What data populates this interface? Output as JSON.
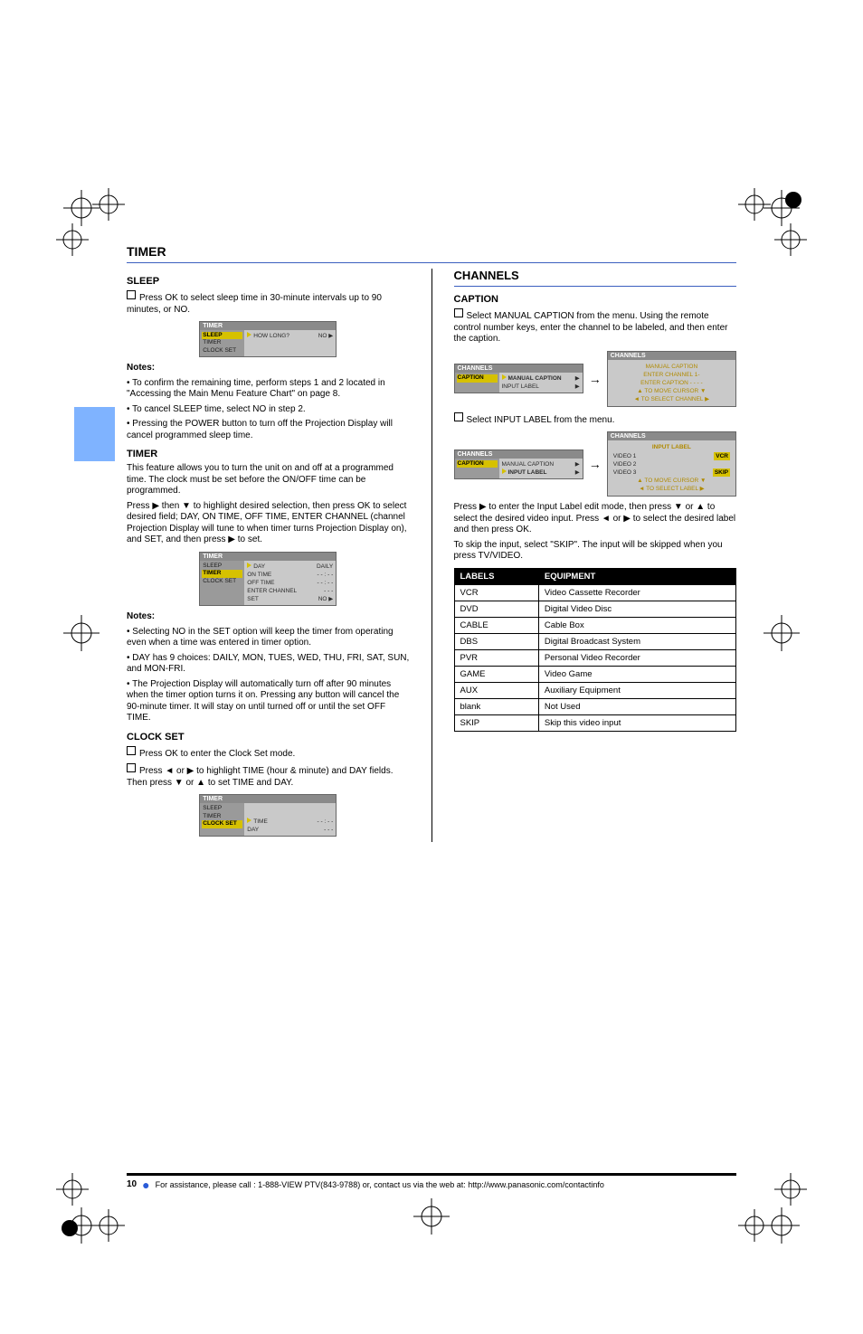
{
  "page": {
    "header_title": "TIMER",
    "footer_page": "10",
    "footer_note": "For assistance, please call : 1-888-VIEW PTV(843-9788) or, contact us via the web at: http://www.panasonic.com/contactinfo"
  },
  "left": {
    "sleep": {
      "title": "SLEEP",
      "bullet": "Press OK to select sleep time in 30-minute intervals up to 90 minutes, or NO.",
      "notes_heading": "Notes:",
      "note1": "• To confirm the remaining time, perform steps 1 and 2 located in \"Accessing the Main Menu Feature Chart\" on page 8.",
      "note2": "• To cancel SLEEP time, select NO in step 2.",
      "note3": "• Pressing the POWER button to turn off the Projection Display will cancel programmed sleep time.",
      "osd": {
        "header": "TIMER",
        "side": [
          "SLEEP",
          "TIMER",
          "CLOCK SET"
        ],
        "side_highlight_index": 0,
        "row_label": "HOW LONG?",
        "row_value": "NO ▶"
      }
    },
    "timer": {
      "title": "TIMER",
      "intro": "This feature allows you to turn the unit on and off at a programmed time. The clock must be set before the ON/OFF time can be programmed.",
      "step": "Press ▶ then ▼ to highlight desired selection, then press OK to select desired field; DAY, ON TIME, OFF TIME, ENTER CHANNEL (channel Projection Display will tune to when timer turns Projection Display on), and SET, and then press ▶ to set.",
      "notes_heading": "Notes:",
      "n1": "• Selecting NO in the SET option will keep the timer from operating even when a time was entered in timer option.",
      "n2": "• DAY has 9 choices: DAILY, MON, TUES, WED, THU, FRI, SAT, SUN, and MON-FRI.",
      "n3": "• The Projection Display will automatically turn off after 90 minutes when the timer option turns it on. Pressing any button will cancel the 90-minute timer. It will stay on until turned off or until the set OFF TIME.",
      "osd": {
        "header": "TIMER",
        "side": [
          "SLEEP",
          "TIMER",
          "CLOCK SET"
        ],
        "side_highlight_index": 1,
        "rows": [
          {
            "label": "DAY",
            "value": "DAILY"
          },
          {
            "label": "ON TIME",
            "value": "- - : - -"
          },
          {
            "label": "OFF TIME",
            "value": "- - : - -"
          },
          {
            "label": "ENTER CHANNEL",
            "value": "- - -"
          },
          {
            "label": "SET",
            "value": "NO ▶"
          }
        ]
      }
    },
    "clock": {
      "title": "CLOCK SET",
      "b1": "Press OK to enter the Clock Set mode.",
      "b2": "Press ◄ or ▶ to highlight TIME (hour & minute) and DAY fields. Then press ▼ or ▲ to set TIME and DAY.",
      "osd": {
        "header": "TIMER",
        "side": [
          "SLEEP",
          "TIMER",
          "CLOCK SET"
        ],
        "side_highlight_index": 2,
        "rows": [
          {
            "label": "TIME",
            "value": "- - : - -"
          },
          {
            "label": "DAY",
            "value": "- - -"
          }
        ]
      }
    }
  },
  "right": {
    "channels_section_title": "CHANNELS",
    "caption": {
      "title": "CAPTION",
      "manual_bullet": "Select MANUAL CAPTION from the menu. Using the remote control number keys, enter the channel to be labeled, and then enter the caption.",
      "manual_osd_left": {
        "header": "CHANNELS",
        "side": [
          "CAPTION"
        ],
        "rows": [
          {
            "label": "MANUAL CAPTION",
            "value": "▶",
            "bold": true
          },
          {
            "label": "INPUT LABEL",
            "value": "▶"
          }
        ]
      },
      "manual_osd_right": {
        "header": "CHANNELS",
        "lines": [
          "MANUAL CAPTION",
          "ENTER CHANNEL     1-",
          "ENTER CAPTION     - - - -",
          "▲  TO MOVE CURSOR  ▼",
          "◄  TO SELECT CHANNEL  ▶"
        ]
      },
      "input_bullet": "Select INPUT LABEL from the menu.",
      "input_osd_left": {
        "header": "CHANNELS",
        "side": [
          "CAPTION"
        ],
        "rows": [
          {
            "label": "MANUAL CAPTION",
            "value": "▶"
          },
          {
            "label": "INPUT LABEL",
            "value": "▶",
            "bold": true
          }
        ]
      },
      "input_osd_right": {
        "header": "CHANNELS",
        "title_line": "INPUT LABEL",
        "rows": [
          {
            "label": "VIDEO 1",
            "value": "VCR",
            "hl": true
          },
          {
            "label": "VIDEO 2",
            "value": ""
          },
          {
            "label": "VIDEO 3",
            "value": "SKIP",
            "hl": true
          }
        ],
        "foot": [
          "▲  TO MOVE CURSOR  ▼",
          "◄  TO SELECT LABEL  ▶"
        ]
      },
      "instr1": "Press ▶ to enter the Input Label edit mode, then press ▼ or ▲ to select the desired video input. Press ◄ or ▶ to select the desired label and then press OK.",
      "instr2": "To skip the input, select \"SKIP\". The input will be skipped when you press TV/VIDEO."
    }
  },
  "table": {
    "head": [
      "LABELS",
      "EQUIPMENT"
    ],
    "rows": [
      [
        "VCR",
        "Video Cassette Recorder"
      ],
      [
        "DVD",
        "Digital Video Disc"
      ],
      [
        "CABLE",
        "Cable Box"
      ],
      [
        "DBS",
        "Digital Broadcast System"
      ],
      [
        "PVR",
        "Personal Video Recorder"
      ],
      [
        "GAME",
        "Video Game"
      ],
      [
        "AUX",
        "Auxiliary Equipment"
      ],
      [
        "blank",
        "Not Used"
      ],
      [
        "SKIP",
        "Skip this video input"
      ]
    ]
  }
}
